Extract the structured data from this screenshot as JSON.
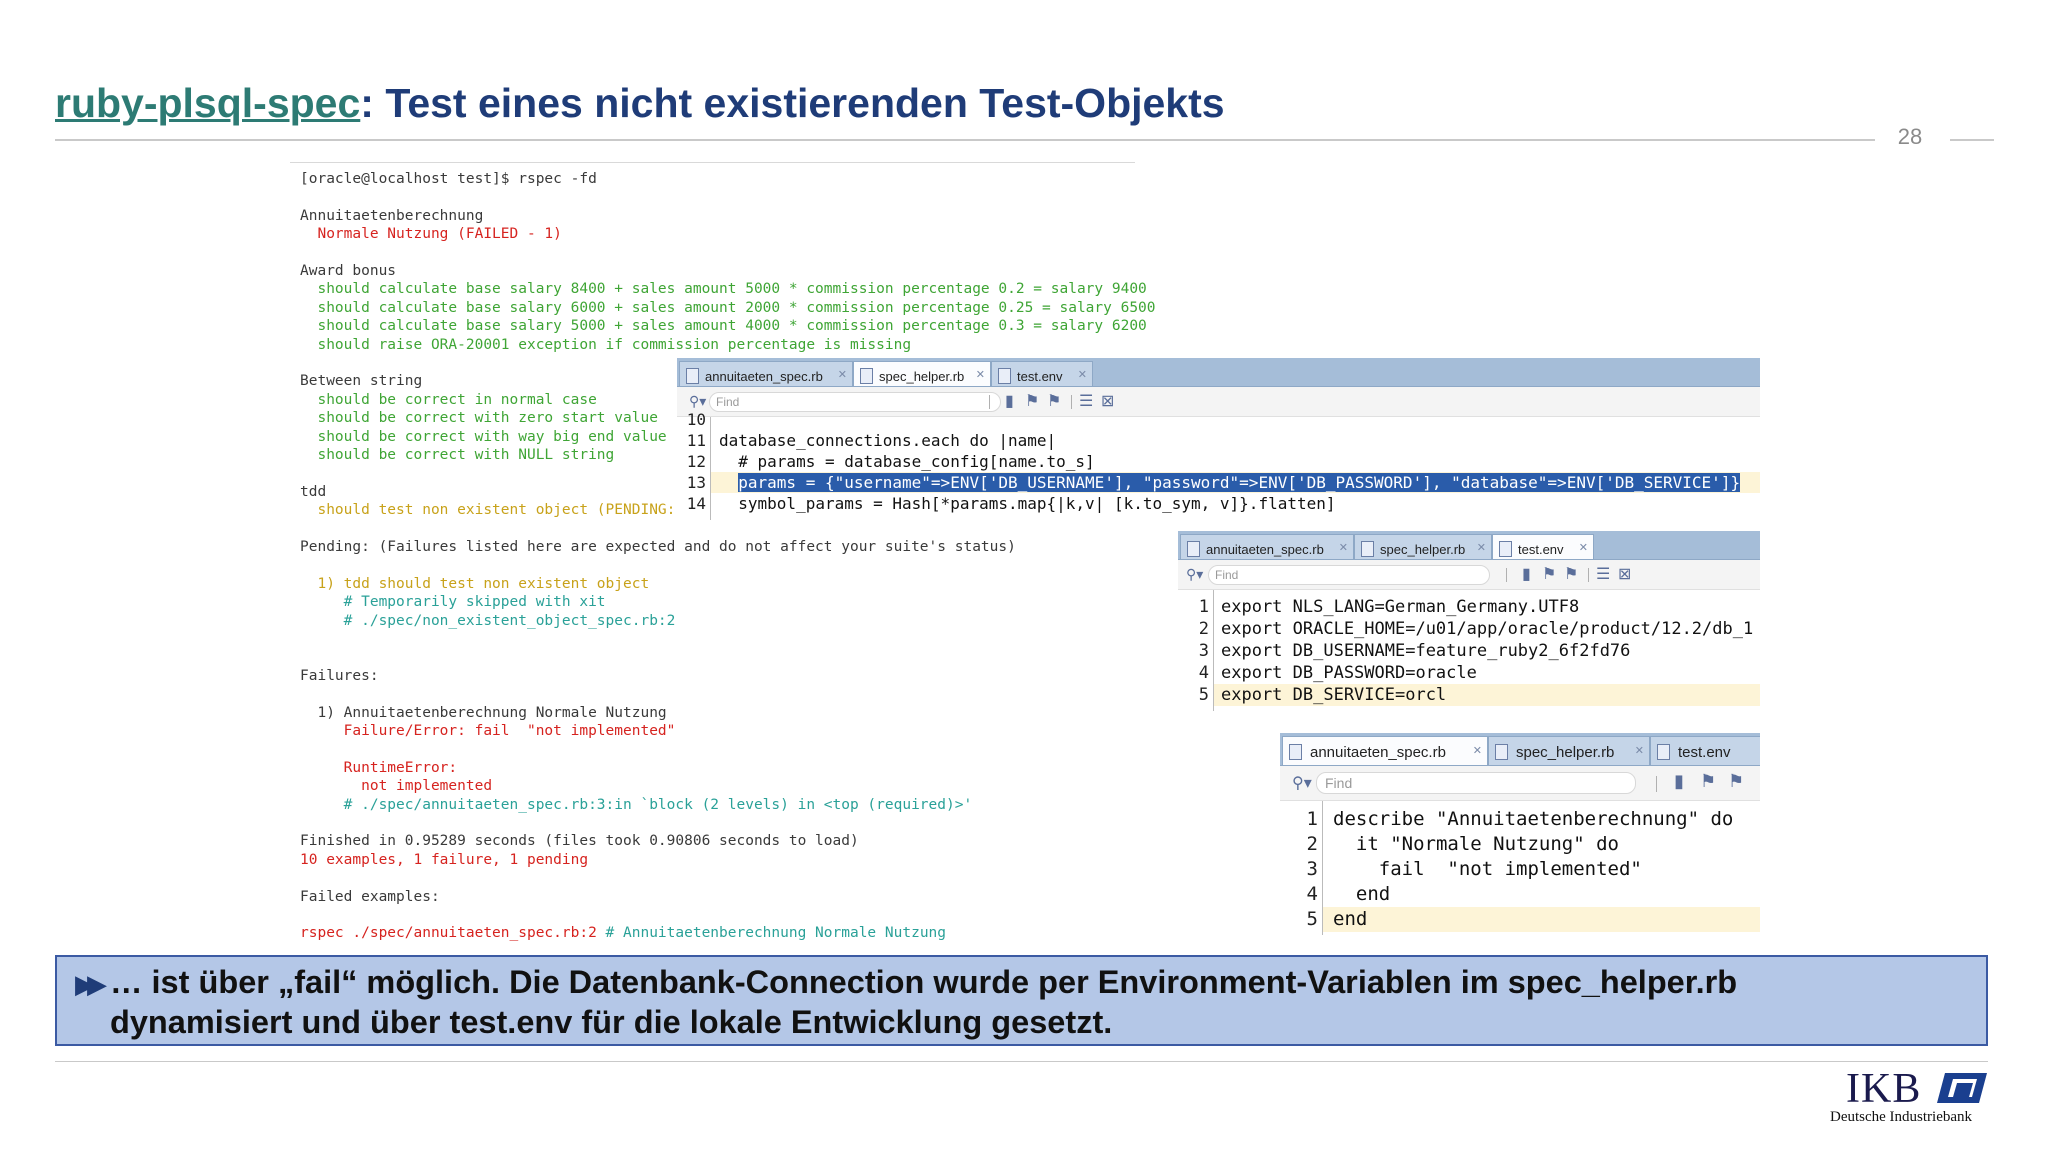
{
  "slide": {
    "title_link": "ruby-plsql-spec",
    "title_rest": ": Test eines nicht existierenden Test-Objekts",
    "page_number": "28"
  },
  "terminal": {
    "lines": [
      {
        "text": "[oracle@localhost test]$ rspec -fd",
        "color": "plain"
      },
      {
        "text": "",
        "color": "plain"
      },
      {
        "text": "Annuitaetenberechnung",
        "color": "plain"
      },
      {
        "text": "  Normale Nutzung (FAILED - 1)",
        "color": "red"
      },
      {
        "text": "",
        "color": "plain"
      },
      {
        "text": "Award bonus",
        "color": "plain"
      },
      {
        "text": "  should calculate base salary 8400 + sales amount 5000 * commission percentage 0.2 = salary 9400",
        "color": "green"
      },
      {
        "text": "  should calculate base salary 6000 + sales amount 2000 * commission percentage 0.25 = salary 6500",
        "color": "green"
      },
      {
        "text": "  should calculate base salary 5000 + sales amount 4000 * commission percentage 0.3 = salary 6200",
        "color": "green"
      },
      {
        "text": "  should raise ORA-20001 exception if commission percentage is missing",
        "color": "green"
      },
      {
        "text": "",
        "color": "plain"
      },
      {
        "text": "Between string",
        "color": "plain"
      },
      {
        "text": "  should be correct in normal case",
        "color": "green"
      },
      {
        "text": "  should be correct with zero start value",
        "color": "green"
      },
      {
        "text": "  should be correct with way big end value",
        "color": "green"
      },
      {
        "text": "  should be correct with NULL string",
        "color": "green"
      },
      {
        "text": "",
        "color": "plain"
      },
      {
        "text": "tdd",
        "color": "plain"
      },
      {
        "text": "  should test non existent object (PENDING:",
        "color": "yellow"
      },
      {
        "text": "",
        "color": "plain"
      },
      {
        "text": "Pending: (Failures listed here are expected and do not affect your suite's status)",
        "color": "plain"
      },
      {
        "text": "",
        "color": "plain"
      },
      {
        "text": "  1) tdd should test non existent object",
        "color": "yellow"
      },
      {
        "text": "     # Temporarily skipped with xit",
        "color": "cyan"
      },
      {
        "text": "     # ./spec/non_existent_object_spec.rb:2",
        "color": "cyan"
      },
      {
        "text": "",
        "color": "plain"
      },
      {
        "text": "",
        "color": "plain"
      },
      {
        "text": "Failures:",
        "color": "plain"
      },
      {
        "text": "",
        "color": "plain"
      },
      {
        "text": "  1) Annuitaetenberechnung Normale Nutzung",
        "color": "plain"
      },
      {
        "text": "     Failure/Error: fail  \"not implemented\"",
        "color": "red"
      },
      {
        "text": "",
        "color": "plain"
      },
      {
        "text": "     RuntimeError:",
        "color": "red"
      },
      {
        "text": "       not implemented",
        "color": "red"
      },
      {
        "text": "     # ./spec/annuitaeten_spec.rb:3:in `block (2 levels) in <top (required)>'",
        "color": "cyan"
      },
      {
        "text": "",
        "color": "plain"
      },
      {
        "text": "Finished in 0.95289 seconds (files took 0.90806 seconds to load)",
        "color": "plain"
      },
      {
        "text": "10 examples, 1 failure, 1 pending",
        "color": "red"
      },
      {
        "text": "",
        "color": "plain"
      },
      {
        "text": "Failed examples:",
        "color": "plain"
      },
      {
        "text": "",
        "color": "plain"
      }
    ],
    "last_line_cmd": "rspec ./spec/annuitaeten_spec.rb:2",
    "last_line_comment": " # Annuitaetenberechnung Normale Nutzung"
  },
  "editor_tabs": [
    "annuitaeten_spec.rb",
    "spec_helper.rb",
    "test.env"
  ],
  "find_placeholder": "Find",
  "editor1": {
    "active_tab": "spec_helper.rb",
    "partial_line_number": "10",
    "lines": [
      {
        "n": "11",
        "code": "database_connections.each do |name|"
      },
      {
        "n": "12",
        "code": "  # params = database_config[name.to_s]"
      },
      {
        "n": "13",
        "code_indent": "  ",
        "code_sel": "params = {\"username\"=>ENV['DB_USERNAME'], \"password\"=>ENV['DB_PASSWORD'], \"database\"=>ENV['DB_SERVICE']}"
      },
      {
        "n": "14",
        "code": "  symbol_params = Hash[*params.map{|k,v| [k.to_sym, v]}.flatten]"
      }
    ]
  },
  "editor2": {
    "active_tab": "test.env",
    "lines": [
      {
        "n": "1",
        "code": "export NLS_LANG=German_Germany.UTF8"
      },
      {
        "n": "2",
        "code": "export ORACLE_HOME=/u01/app/oracle/product/12.2/db_1"
      },
      {
        "n": "3",
        "code": "export DB_USERNAME=feature_ruby2_6f2fd76"
      },
      {
        "n": "4",
        "code": "export DB_PASSWORD=oracle"
      },
      {
        "n": "5",
        "code": "export DB_SERVICE=orcl"
      }
    ]
  },
  "editor3": {
    "active_tab": "annuitaeten_spec.rb",
    "lines": [
      {
        "n": "1",
        "code": "describe \"Annuitaetenberechnung\" do"
      },
      {
        "n": "2",
        "code": "  it \"Normale Nutzung\" do"
      },
      {
        "n": "3",
        "code": "    fail  \"not implemented\""
      },
      {
        "n": "4",
        "code": "  end"
      },
      {
        "n": "5",
        "code": "end"
      }
    ]
  },
  "callout": {
    "line1": "… ist über „fail“ möglich. Die Datenbank-Connection wurde per Environment-Variablen im spec_helper.rb",
    "line2": "dynamisiert und über test.env für die lokale Entwicklung gesetzt."
  },
  "logo": {
    "name": "IKB",
    "subtitle": "Deutsche Industriebank"
  },
  "colors": {
    "title_blue": "#1f3c78",
    "title_link_teal": "#2d7b74",
    "callout_bg": "#b4c7e7",
    "callout_border": "#3b5aa3",
    "term_green": "#3fa535",
    "term_red": "#d6231f",
    "term_yellow": "#c8a21a",
    "term_cyan": "#2aa198",
    "selection_blue": "#2a5caa",
    "current_line": "#fdf4d7",
    "tabbar": "#a5bdd8"
  }
}
